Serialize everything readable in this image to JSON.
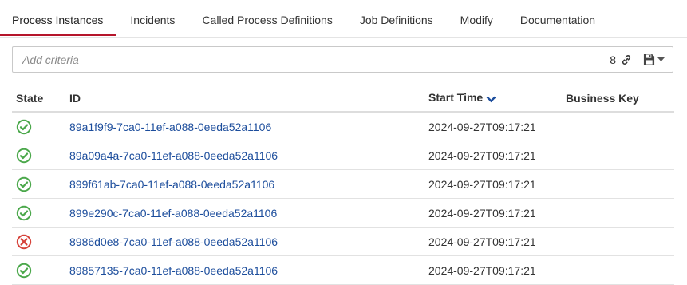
{
  "tabs": [
    {
      "label": "Process Instances",
      "active": true
    },
    {
      "label": "Incidents",
      "active": false
    },
    {
      "label": "Called Process Definitions",
      "active": false
    },
    {
      "label": "Job Definitions",
      "active": false
    },
    {
      "label": "Modify",
      "active": false
    },
    {
      "label": "Documentation",
      "active": false
    }
  ],
  "search": {
    "placeholder": "Add criteria",
    "count": "8"
  },
  "table": {
    "columns": [
      "State",
      "ID",
      "Start Time",
      "Business Key"
    ],
    "sort_column": "Start Time",
    "sort_direction": "descending",
    "rows": [
      {
        "state": "completed",
        "id": "89a1f9f9-7ca0-11ef-a088-0eeda52a1106",
        "start_time": "2024-09-27T09:17:21",
        "business_key": ""
      },
      {
        "state": "completed",
        "id": "89a09a4a-7ca0-11ef-a088-0eeda52a1106",
        "start_time": "2024-09-27T09:17:21",
        "business_key": ""
      },
      {
        "state": "completed",
        "id": "899f61ab-7ca0-11ef-a088-0eeda52a1106",
        "start_time": "2024-09-27T09:17:21",
        "business_key": ""
      },
      {
        "state": "completed",
        "id": "899e290c-7ca0-11ef-a088-0eeda52a1106",
        "start_time": "2024-09-27T09:17:21",
        "business_key": ""
      },
      {
        "state": "failed",
        "id": "8986d0e8-7ca0-11ef-a088-0eeda52a1106",
        "start_time": "2024-09-27T09:17:21",
        "business_key": ""
      },
      {
        "state": "completed",
        "id": "89857135-7ca0-11ef-a088-0eeda52a1106",
        "start_time": "2024-09-27T09:17:21",
        "business_key": ""
      }
    ]
  },
  "colors": {
    "active_tab_underline": "#b5152b",
    "link": "#1c4d9c",
    "success": "#4ba84b",
    "error": "#d6423a",
    "sort_arrow": "#1c4d9c"
  },
  "icons": {
    "completed": "check-circle-icon",
    "failed": "x-circle-icon",
    "permalink": "link-icon",
    "save": "floppy-disk-icon",
    "sort": "chevron-down-icon"
  }
}
